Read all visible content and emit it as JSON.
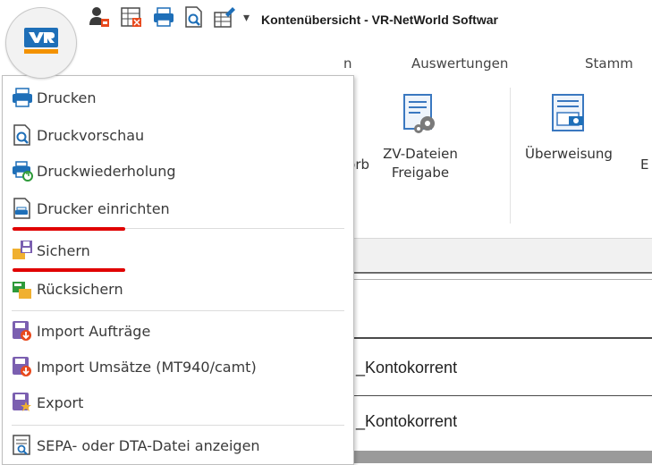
{
  "window": {
    "title": "Kontenübersicht - VR-NetWorld Softwar",
    "qat_dropdown": "▾"
  },
  "ribbon": {
    "tabs": [
      {
        "label": "n"
      },
      {
        "label": "Auswertungen"
      },
      {
        "label": "Stamm"
      }
    ],
    "buttons": [
      {
        "label_line1": "korb",
        "label_line2": ""
      },
      {
        "label_line1": "ZV-Dateien",
        "label_line2": "Freigabe"
      },
      {
        "label_line1": "Überweisung",
        "label_line2": ""
      },
      {
        "label_line1": "E",
        "label_line2": ""
      }
    ]
  },
  "rows": [
    {
      "text": "_Kontokorrent"
    },
    {
      "text": "_Kontokorrent"
    }
  ],
  "app_menu": {
    "items": [
      {
        "label": "Drucken",
        "icon": "printer-icon"
      },
      {
        "label": "Druckvorschau",
        "icon": "print-preview-icon"
      },
      {
        "label": "Druckwiederholung",
        "icon": "print-repeat-icon"
      },
      {
        "label": "Drucker einrichten",
        "icon": "printer-setup-icon"
      },
      {
        "label": "Sichern",
        "icon": "backup-icon"
      },
      {
        "label": "Rücksichern",
        "icon": "restore-icon"
      },
      {
        "label": "Import Aufträge",
        "icon": "import-orders-icon"
      },
      {
        "label": "Import Umsätze (MT940/camt)",
        "icon": "import-transactions-icon"
      },
      {
        "label": "Export",
        "icon": "export-icon"
      },
      {
        "label": "SEPA- oder DTA-Datei anzeigen",
        "icon": "sepa-file-icon"
      }
    ]
  },
  "colors": {
    "accent_blue": "#1e6fb8",
    "highlight_red": "#e00000",
    "logo_orange": "#f39200"
  }
}
